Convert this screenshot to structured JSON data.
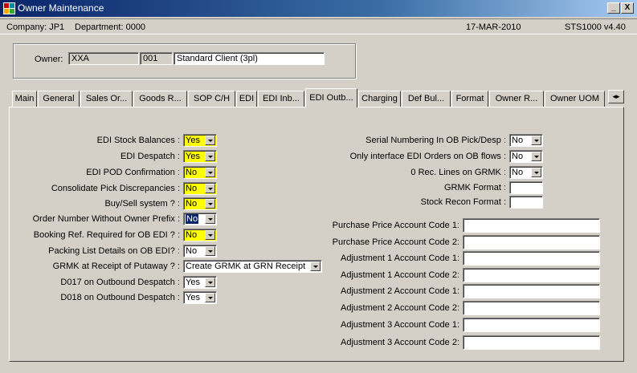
{
  "window": {
    "title": "Owner Maintenance",
    "minimize": "_",
    "close": "X"
  },
  "info": {
    "company": "Company: JP1",
    "department": "Department: 0000",
    "date": "17-MAR-2010",
    "program": "STS1000  v4.40"
  },
  "owner": {
    "label": "Owner:",
    "code": "XXA",
    "number": "001",
    "name": "Standard Client (3pl)"
  },
  "tabs": [
    "Main",
    "General",
    "Sales Or...",
    "Goods R...",
    "SOP C/H",
    "EDI",
    "EDI Inb...",
    "EDI Outb...",
    "Charging",
    "Def Bul...",
    "Format",
    "Owner R...",
    "Owner UOM"
  ],
  "active_tab": "EDI Outb...",
  "tab_scroll": "◂▸",
  "left_fields": [
    {
      "label": "EDI Stock Balances :",
      "value": "Yes"
    },
    {
      "label": "EDI Despatch :",
      "value": "Yes"
    },
    {
      "label": "EDI POD Confirmation :",
      "value": "No"
    },
    {
      "label": "Consolidate Pick Discrepancies :",
      "value": "No"
    },
    {
      "label": "Buy/Sell system ? :",
      "value": "No"
    },
    {
      "label": "Order Number Without Owner Prefix :",
      "value": "No"
    },
    {
      "label": "Booking Ref. Required for OB EDI ? :",
      "value": "No"
    },
    {
      "label": "Packing List Details on OB EDI? :",
      "value": "No"
    },
    {
      "label": "GRMK at Receipt of Putaway ? :",
      "value": "Create GRMK at GRN Receipt"
    },
    {
      "label": "D017 on Outbound Despatch :",
      "value": "Yes"
    },
    {
      "label": "D018 on Outbound Despatch :",
      "value": "Yes"
    }
  ],
  "right_combos": [
    {
      "label": "Serial Numbering In OB Pick/Desp :",
      "value": "No"
    },
    {
      "label": "Only interface EDI Orders on OB flows :",
      "value": "No"
    },
    {
      "label": "0 Rec. Lines on GRMK :",
      "value": "No"
    }
  ],
  "right_small": [
    {
      "label": "GRMK Format :",
      "value": ""
    },
    {
      "label": "Stock Recon  Format :",
      "value": ""
    }
  ],
  "account_codes": [
    {
      "label": "Purchase Price Account Code 1:",
      "value": ""
    },
    {
      "label": "Purchase Price Account Code 2:",
      "value": ""
    },
    {
      "label": "Adjustment 1 Account Code 1:",
      "value": ""
    },
    {
      "label": "Adjustment 1 Account Code 2:",
      "value": ""
    },
    {
      "label": "Adjustment 2 Account Code 1:",
      "value": ""
    },
    {
      "label": "Adjustment 2 Account Code 2:",
      "value": ""
    },
    {
      "label": "Adjustment 3 Account Code 1:",
      "value": ""
    },
    {
      "label": "Adjustment 3 Account Code 2:",
      "value": ""
    }
  ],
  "colors": {
    "title_start": "#0a246a",
    "title_end": "#a6caf0",
    "highlight": "#ffff00",
    "face": "#d4d0c8"
  }
}
